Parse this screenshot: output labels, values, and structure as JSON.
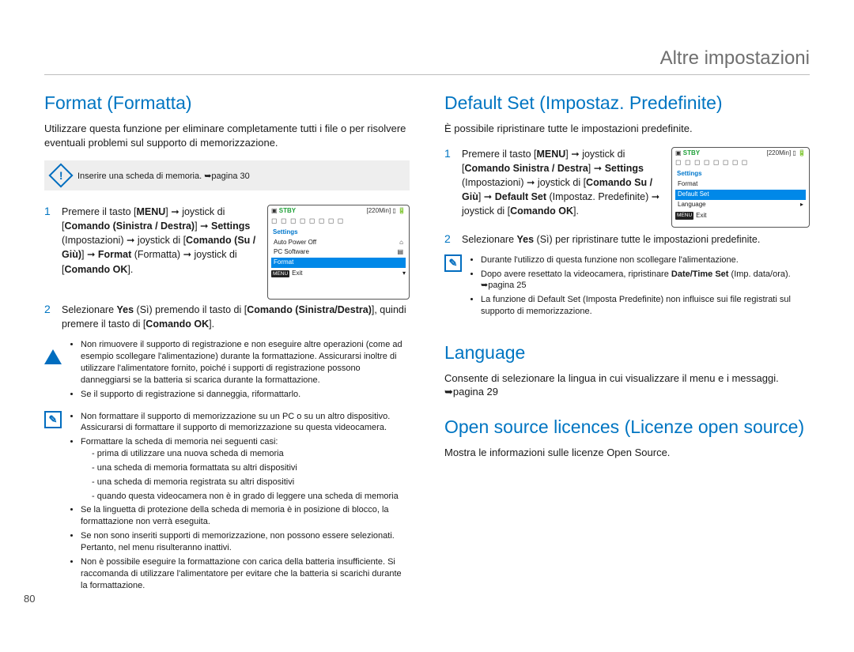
{
  "header": {
    "title": "Altre impostazioni"
  },
  "page_number": "80",
  "format": {
    "heading": "Format (Formatta)",
    "intro": "Utilizzare questa funzione per eliminare completamente tutti i file o per risolvere eventuali problemi sul supporto di memorizzazione.",
    "note": "Inserire una scheda di memoria. ➥pagina 30",
    "step1_a": "Premere il tasto [",
    "step1_b": "] ➞ joystick di [",
    "step1_c": "] ➞ ",
    "step1_d": " (Impostazioni) ➞ joystick di [",
    "step1_e": "] ➞ ",
    "step1_f": " (Formatta) ➞ joystick di [",
    "step1_g": "].",
    "kw_menu": "MENU",
    "kw_lr": "Comando (Sinistra / Destra)",
    "kw_settings": "Settings",
    "kw_ud": "Comando (Su / Giù)",
    "kw_format": "Format",
    "kw_ok": "Comando OK",
    "step2_a": "Selezionare ",
    "step2_yes": "Yes",
    "step2_b": " (Sì) premendo il tasto di [",
    "step2_lr2": "Comando (Sinistra/Destra)",
    "step2_c": "], quindi premere il tasto di [",
    "step2_d": "].",
    "warn_bullets": [
      "Non rimuovere il supporto di registrazione e non eseguire altre operazioni (come ad esempio scollegare l'alimentazione) durante la formattazione. Assicurarsi inoltre di utilizzare l'alimentatore fornito, poiché i supporti di registrazione possono danneggiarsi se la batteria si scarica durante la formattazione.",
      "Se il supporto di registrazione si danneggia, riformattarlo."
    ],
    "info_bullets_head": [
      "Non formattare il supporto di memorizzazione su un PC o su un altro dispositivo. Assicurarsi di formattare il supporto di memorizzazione su questa videocamera.",
      "Formattare la scheda di memoria nei seguenti casi:"
    ],
    "info_sub": [
      "prima di utilizzare una nuova scheda di memoria",
      "una scheda di memoria formattata su altri dispositivi",
      "una scheda di memoria registrata su altri dispositivi",
      "quando questa videocamera non è in grado di leggere una scheda di memoria"
    ],
    "info_bullets_tail": [
      "Se la linguetta di protezione della scheda di memoria è in posizione di blocco, la formattazione non verrà eseguita.",
      "Se non sono inseriti supporti di memorizzazione, non possono essere selezionati. Pertanto, nel menu risulteranno inattivi.",
      "Non è possibile eseguire la formattazione con carica della batteria insufficiente. Si raccomanda di utilizzare l'alimentatore per evitare che la batteria si scarichi durante la formattazione."
    ],
    "lcd": {
      "stby": "STBY",
      "time": "220Min",
      "head": "Settings",
      "row1": "Auto Power Off",
      "row2": "PC Software",
      "row3": "Format",
      "exit": "Exit"
    }
  },
  "default_set": {
    "heading": "Default Set (Impostaz. Predefinite)",
    "intro": "È possibile ripristinare tutte le impostazioni predefinite.",
    "step1_parts": [
      "Premere il tasto [",
      "] ➞ joystick di [",
      "] ➞ ",
      " (Impostazioni) ➞ joystick di [",
      "] ➞ ",
      " (Impostaz. Predefinite) ➞ joystick di [",
      "]."
    ],
    "kw_menu": "MENU",
    "kw_lr": "Comando Sinistra / Destra",
    "kw_settings": "Settings",
    "kw_ud": "Comando Su / Giù",
    "kw_ds": "Default Set",
    "kw_ok": "Comando OK",
    "step2_a": "Selezionare ",
    "step2_yes": "Yes",
    "step2_b": " (Sì) per ripristinare tutte le impostazioni predefinite.",
    "info_bullets": [
      "Durante l'utilizzo di questa funzione non scollegare l'alimentazione.",
      "Dopo avere resettato la videocamera, ripristinare Date/Time Set (Imp. data/ora). ➥pagina 25",
      "La funzione di Default Set (Imposta Predefinite) non influisce sui file registrati sul supporto di memorizzazione."
    ],
    "info_bullet_date_bold": "Date/Time Set",
    "lcd": {
      "stby": "STBY",
      "time": "220Min",
      "head": "Settings",
      "row1": "Format",
      "row2": "Default Set",
      "row3": "Language",
      "exit": "Exit"
    }
  },
  "language": {
    "heading": "Language",
    "body": "Consente di selezionare la lingua in cui visualizzare il menu e i messaggi. ➥pagina 29"
  },
  "opensource": {
    "heading": "Open source licences (Licenze open source)",
    "body": "Mostra le informazioni sulle licenze Open Source."
  }
}
